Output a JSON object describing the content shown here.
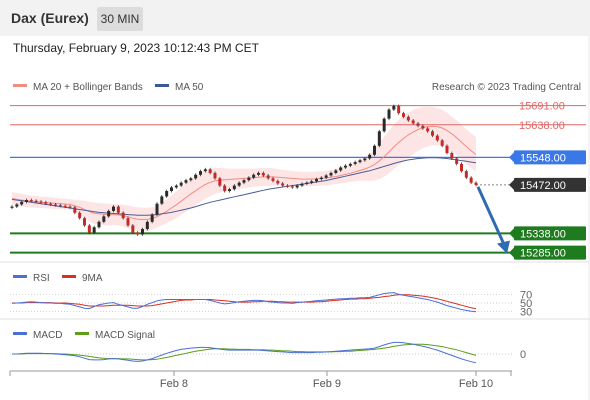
{
  "header": {
    "title": "Dax (Eurex)",
    "timeframe": "30 MIN",
    "datetime": "Thursday, February 9, 2023 10:12:43 PM CET",
    "copyright": "Research © 2023 Trading Central"
  },
  "colors": {
    "resistance": "#e06666",
    "pivot": "#3b78e7",
    "support": "#1e7b1e",
    "current": "#333333",
    "ma20": "#f28b82",
    "ma50": "#4a5e9a",
    "bollinger_fill": "#fde0e0",
    "rsi": "#4a6fd8",
    "rsi_ma": "#d93025",
    "macd": "#4a6fd8",
    "macd_signal": "#5a9e1a",
    "arrow": "#2e6bb0"
  },
  "chart_data": [
    {
      "type": "line",
      "name": "price",
      "legend": [
        {
          "label": "MA 20 + Bollinger Bands",
          "color": "#f28b82"
        },
        {
          "label": "MA 50",
          "color": "#3b5998"
        }
      ],
      "ylim": [
        15270,
        15712
      ],
      "x_ticks": [
        "Feb 8",
        "Feb 9",
        "Feb 10"
      ],
      "levels": [
        {
          "value": 15691.0,
          "label": "15691.00",
          "kind": "resistance"
        },
        {
          "value": 15638.0,
          "label": "15638.00",
          "kind": "resistance"
        },
        {
          "value": 15548.0,
          "label": "15548.00",
          "kind": "pivot"
        },
        {
          "value": 15472.0,
          "label": "15472.00",
          "kind": "current"
        },
        {
          "value": 15338.0,
          "label": "15338.00",
          "kind": "support"
        },
        {
          "value": 15285.0,
          "label": "15285.00",
          "kind": "support"
        }
      ],
      "close": [
        15412,
        15418,
        15425,
        15430,
        15428,
        15426,
        15424,
        15420,
        15418,
        15416,
        15414,
        15412,
        15410,
        15395,
        15380,
        15360,
        15340,
        15355,
        15370,
        15385,
        15400,
        15412,
        15395,
        15380,
        15360,
        15340,
        15335,
        15350,
        15370,
        15390,
        15420,
        15440,
        15455,
        15465,
        15470,
        15478,
        15485,
        15490,
        15500,
        15510,
        15515,
        15505,
        15490,
        15470,
        15455,
        15460,
        15470,
        15478,
        15485,
        15492,
        15500,
        15505,
        15498,
        15490,
        15483,
        15476,
        15470,
        15468,
        15465,
        15470,
        15475,
        15478,
        15482,
        15488,
        15492,
        15498,
        15505,
        15512,
        15520,
        15525,
        15530,
        15535,
        15540,
        15545,
        15555,
        15580,
        15620,
        15655,
        15680,
        15690,
        15670,
        15660,
        15650,
        15642,
        15635,
        15628,
        15620,
        15608,
        15595,
        15580,
        15560,
        15545,
        15530,
        15510,
        15492,
        15478,
        15472
      ],
      "ma20": [
        15435,
        15432,
        15430,
        15428,
        15426,
        15425,
        15424,
        15423,
        15422,
        15421,
        15420,
        15419,
        15418,
        15414,
        15410,
        15404,
        15398,
        15394,
        15392,
        15391,
        15390,
        15390,
        15389,
        15387,
        15384,
        15380,
        15377,
        15376,
        15377,
        15379,
        15384,
        15391,
        15399,
        15408,
        15417,
        15427,
        15437,
        15447,
        15456,
        15465,
        15473,
        15479,
        15483,
        15485,
        15486,
        15487,
        15488,
        15489,
        15490,
        15491,
        15492,
        15493,
        15494,
        15494,
        15494,
        15493,
        15492,
        15491,
        15490,
        15489,
        15488,
        15488,
        15488,
        15489,
        15490,
        15491,
        15493,
        15495,
        15498,
        15501,
        15504,
        15508,
        15512,
        15516,
        15521,
        15528,
        15538,
        15550,
        15563,
        15577,
        15589,
        15600,
        15610,
        15618,
        15625,
        15630,
        15633,
        15634,
        15633,
        15629,
        15622,
        15613,
        15602,
        15590,
        15578,
        15566,
        15556
      ],
      "ma50": [
        15432,
        15430,
        15428,
        15426,
        15424,
        15422,
        15420,
        15418,
        15416,
        15414,
        15412,
        15410,
        15408,
        15406,
        15404,
        15402,
        15400,
        15398,
        15396,
        15395,
        15394,
        15393,
        15392,
        15391,
        15390,
        15389,
        15388,
        15388,
        15388,
        15389,
        15390,
        15392,
        15394,
        15396,
        15399,
        15402,
        15405,
        15408,
        15412,
        15416,
        15420,
        15424,
        15427,
        15430,
        15433,
        15436,
        15439,
        15442,
        15445,
        15448,
        15451,
        15454,
        15457,
        15460,
        15462,
        15464,
        15466,
        15468,
        15470,
        15472,
        15474,
        15476,
        15478,
        15480,
        15482,
        15484,
        15487,
        15490,
        15493,
        15496,
        15499,
        15502,
        15505,
        15508,
        15511,
        15515,
        15519,
        15523,
        15527,
        15531,
        15535,
        15538,
        15541,
        15543,
        15545,
        15546,
        15547,
        15547,
        15547,
        15546,
        15545,
        15543,
        15541,
        15539,
        15537,
        15535,
        15533
      ],
      "boll_width": [
        35,
        35,
        34,
        34,
        33,
        33,
        32,
        32,
        31,
        31,
        30,
        30,
        30,
        34,
        40,
        48,
        55,
        58,
        60,
        60,
        60,
        58,
        58,
        60,
        62,
        64,
        66,
        66,
        64,
        62,
        60,
        62,
        66,
        70,
        74,
        76,
        78,
        80,
        80,
        80,
        78,
        76,
        72,
        68,
        64,
        60,
        58,
        56,
        54,
        52,
        50,
        50,
        50,
        50,
        48,
        46,
        44,
        42,
        40,
        40,
        40,
        40,
        40,
        40,
        40,
        40,
        40,
        42,
        44,
        46,
        48,
        52,
        58,
        66,
        76,
        88,
        100,
        110,
        118,
        124,
        126,
        126,
        124,
        122,
        118,
        114,
        110,
        106,
        102,
        100,
        98,
        96,
        96,
        96,
        96,
        96,
        96
      ],
      "forecast_arrow": {
        "from": 15472,
        "to": 15285
      }
    },
    {
      "type": "line",
      "name": "rsi",
      "legend": [
        {
          "label": "RSI",
          "color": "#4a6fd8"
        },
        {
          "label": "9MA",
          "color": "#d93025"
        }
      ],
      "levels": [
        "70",
        "50",
        "30"
      ],
      "ylim": [
        20,
        80
      ],
      "rsi": [
        49,
        50,
        51,
        52,
        53,
        52,
        51,
        50,
        50,
        49,
        49,
        48,
        47,
        44,
        41,
        38,
        37,
        42,
        46,
        48,
        50,
        51,
        47,
        44,
        41,
        38,
        38,
        42,
        47,
        51,
        55,
        57,
        58,
        58,
        58,
        58,
        58,
        58,
        58,
        58,
        58,
        56,
        53,
        50,
        48,
        49,
        51,
        53,
        54,
        55,
        56,
        56,
        55,
        53,
        52,
        51,
        50,
        50,
        49,
        51,
        52,
        53,
        54,
        55,
        56,
        57,
        58,
        59,
        60,
        60,
        61,
        61,
        62,
        62,
        63,
        66,
        69,
        72,
        73,
        74,
        70,
        68,
        66,
        64,
        62,
        60,
        58,
        55,
        52,
        48,
        44,
        41,
        38,
        35,
        33,
        31,
        30
      ],
      "rsi_ma": [
        50,
        50,
        50,
        51,
        51,
        51,
        51,
        51,
        51,
        50,
        50,
        50,
        49,
        48,
        47,
        45,
        43,
        43,
        43,
        43,
        44,
        45,
        45,
        45,
        45,
        44,
        43,
        43,
        43,
        44,
        46,
        48,
        50,
        52,
        54,
        56,
        57,
        57,
        58,
        58,
        58,
        58,
        57,
        56,
        55,
        54,
        53,
        52,
        52,
        52,
        53,
        53,
        54,
        54,
        54,
        53,
        53,
        52,
        52,
        52,
        52,
        52,
        52,
        53,
        53,
        54,
        55,
        56,
        57,
        58,
        59,
        59,
        60,
        60,
        61,
        62,
        63,
        65,
        66,
        68,
        69,
        69,
        69,
        68,
        67,
        66,
        64,
        62,
        60,
        57,
        54,
        51,
        48,
        45,
        42,
        39,
        37
      ]
    },
    {
      "type": "line",
      "name": "macd",
      "legend": [
        {
          "label": "MACD",
          "color": "#4a6fd8"
        },
        {
          "label": "MACD Signal",
          "color": "#5a9e1a"
        }
      ],
      "zero_label": "0",
      "ylim": [
        -40,
        40
      ],
      "macd": [
        0,
        0,
        1,
        2,
        2,
        2,
        2,
        1,
        1,
        0,
        -1,
        -2,
        -3,
        -5,
        -8,
        -12,
        -16,
        -17,
        -17,
        -16,
        -14,
        -13,
        -14,
        -16,
        -18,
        -20,
        -21,
        -20,
        -17,
        -13,
        -8,
        -3,
        2,
        6,
        10,
        13,
        15,
        17,
        18,
        19,
        19,
        18,
        16,
        14,
        12,
        11,
        11,
        11,
        11,
        11,
        11,
        11,
        10,
        9,
        8,
        7,
        6,
        5,
        4,
        4,
        4,
        4,
        4,
        5,
        5,
        6,
        7,
        8,
        9,
        10,
        11,
        12,
        13,
        14,
        15,
        17,
        21,
        26,
        30,
        33,
        33,
        32,
        30,
        28,
        25,
        22,
        19,
        15,
        11,
        6,
        1,
        -4,
        -9,
        -14,
        -18,
        -22,
        -25
      ],
      "signal": [
        0,
        0,
        0,
        1,
        1,
        1,
        1,
        1,
        1,
        1,
        0,
        0,
        -1,
        -2,
        -3,
        -5,
        -7,
        -9,
        -11,
        -12,
        -13,
        -13,
        -13,
        -14,
        -14,
        -15,
        -16,
        -17,
        -17,
        -16,
        -15,
        -12,
        -10,
        -7,
        -4,
        -1,
        2,
        5,
        8,
        10,
        12,
        14,
        15,
        15,
        15,
        14,
        14,
        13,
        13,
        13,
        12,
        12,
        12,
        11,
        11,
        10,
        9,
        9,
        8,
        7,
        7,
        6,
        6,
        6,
        6,
        6,
        6,
        7,
        7,
        8,
        8,
        9,
        10,
        11,
        12,
        13,
        15,
        17,
        19,
        22,
        24,
        26,
        27,
        28,
        28,
        28,
        27,
        25,
        23,
        21,
        18,
        15,
        12,
        8,
        4,
        0,
        -4
      ]
    }
  ]
}
